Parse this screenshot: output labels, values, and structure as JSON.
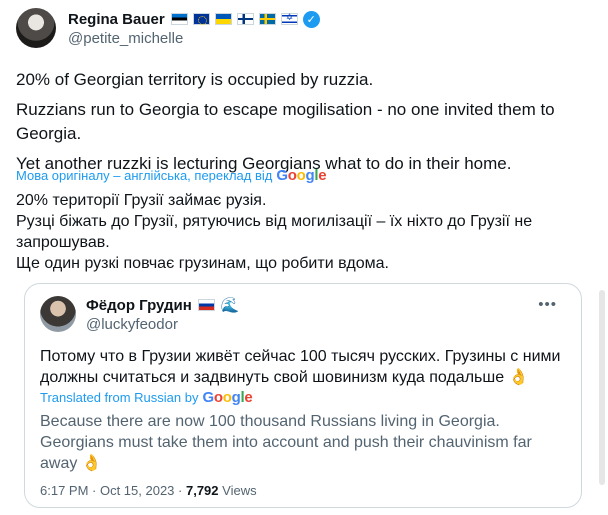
{
  "author": {
    "name": "Regina Bauer",
    "handle": "@petite_michelle"
  },
  "tweet": {
    "lines": [
      "20% of Georgian territory is occupied by ruzzia.",
      "Ruzzians run to Georgia to escape mogilisation - no one invited them to Georgia.",
      "Yet another ruzzki is lecturing Georgians what to do in their home."
    ],
    "translate_label": "Мова оригіналу – англійська, переклад від",
    "translation_lines": [
      "20% території Грузії займає рузія.",
      "Рузці біжать до Грузії, рятуючись від могилізації – їх ніхто до Грузії не запрошував.",
      "Ще один рузкі повчає грузинам, що робити вдома."
    ]
  },
  "quote": {
    "name": "Фёдор Грудин",
    "handle": "@luckyfeodor",
    "text": "Потому что в Грузии живёт сейчас 100 тысяч русских. Грузины с ними должны считаться и задвинуть свой шовинизм куда подальше",
    "translate_label": "Translated from Russian by",
    "translation": "Because there are now 100 thousand Russians living in Georgia. Georgians must take them into account and push their chauvinism far away",
    "time": "6:17 PM · Oct 15, 2023 ·",
    "views_count": "7,792",
    "views_label": "Views"
  },
  "google_logo": "Google",
  "colors": {
    "link": "#1d9bf0",
    "text": "#0f1419",
    "muted": "#536471",
    "border": "#cfd9de"
  }
}
